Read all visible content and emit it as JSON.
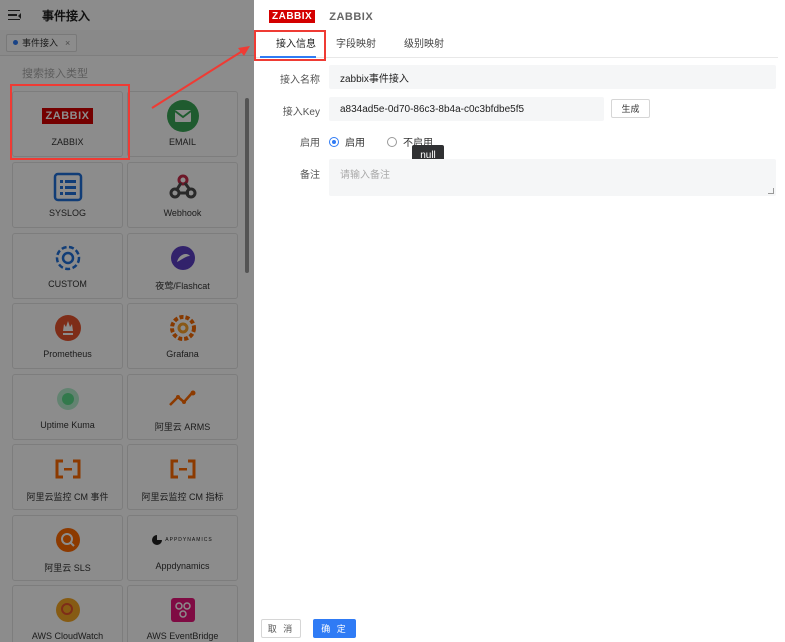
{
  "background_page": {
    "title": "事件接入",
    "tab_label": "事件接入",
    "tab_close": "×",
    "search_placeholder": "搜索接入类型",
    "integrations": [
      {
        "label": "ZABBIX",
        "icon": "zabbix-logo",
        "logo_text": "ZABBIX"
      },
      {
        "label": "EMAIL",
        "icon": "envelope-icon"
      },
      {
        "label": "SYSLOG",
        "icon": "list-icon"
      },
      {
        "label": "Webhook",
        "icon": "webhook-icon"
      },
      {
        "label": "CUSTOM",
        "icon": "gear-icon"
      },
      {
        "label": "夜莺/Flashcat",
        "icon": "flashcat-icon"
      },
      {
        "label": "Prometheus",
        "icon": "prometheus-icon"
      },
      {
        "label": "Grafana",
        "icon": "grafana-icon"
      },
      {
        "label": "Uptime Kuma",
        "icon": "uptime-kuma-icon"
      },
      {
        "label": "阿里云 ARMS",
        "icon": "arms-icon"
      },
      {
        "label": "阿里云监控 CM 事件",
        "icon": "aliyun-icon"
      },
      {
        "label": "阿里云监控 CM 指标",
        "icon": "aliyun-icon"
      },
      {
        "label": "阿里云 SLS",
        "icon": "sls-icon"
      },
      {
        "label": "Appdynamics",
        "icon": "appdynamics-icon",
        "logo_text": "APPDYNAMICS"
      },
      {
        "label": "AWS CloudWatch",
        "icon": "cloudwatch-icon"
      },
      {
        "label": "AWS EventBridge",
        "icon": "eventbridge-icon"
      }
    ]
  },
  "drawer": {
    "logo_text": "ZABBIX",
    "title": "ZABBIX",
    "tabs": [
      "接入信息",
      "字段映射",
      "级别映射"
    ],
    "active_tab": "接入信息",
    "form": {
      "name_label": "接入名称",
      "name_value": "zabbix事件接入",
      "key_label": "接入Key",
      "key_value": "a834ad5e-0d70-86c3-8b4a-c0c3bfdbe5f5",
      "generate_label": "生成",
      "enable_label": "启用",
      "enable_on": "启用",
      "enable_off": "不启用",
      "enabled": true,
      "tooltip": "null",
      "remark_label": "备注",
      "remark_placeholder": "请输入备注"
    },
    "footer": {
      "cancel": "取 消",
      "ok": "确 定"
    }
  },
  "colors": {
    "primary": "#2f7bf5",
    "highlight": "#ef3b34",
    "zabbix_red": "#d40000",
    "overlay": "rgba(0,0,0,0.45)"
  }
}
